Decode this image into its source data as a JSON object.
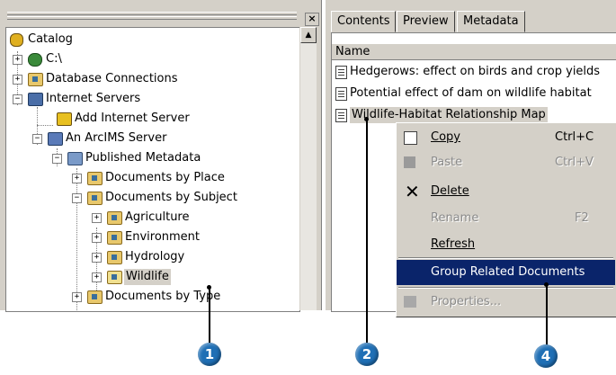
{
  "left": {
    "close_glyph": "×",
    "scroll_up_glyph": "▲",
    "tree": {
      "catalog": "Catalog",
      "c_drive": "C:\\",
      "db_connections": "Database Connections",
      "internet_servers": "Internet Servers",
      "add_internet_server": "Add Internet Server",
      "arcims_server": "An ArcIMS Server",
      "published_metadata": "Published Metadata",
      "docs_by_place": "Documents by Place",
      "docs_by_subject": "Documents by Subject",
      "agriculture": "Agriculture",
      "environment": "Environment",
      "hydrology": "Hydrology",
      "wildlife": "Wildlife",
      "docs_by_type": "Documents by Type"
    }
  },
  "right": {
    "tabs": [
      "Contents",
      "Preview",
      "Metadata"
    ],
    "column_name": "Name",
    "items": [
      "Hedgerows: effect on birds and crop yields",
      "Potential effect of dam on wildlife habitat",
      "Wildlife-Habitat Relationship Map"
    ]
  },
  "context_menu": {
    "copy": "Copy",
    "copy_sc": "Ctrl+C",
    "paste": "Paste",
    "paste_sc": "Ctrl+V",
    "delete": "Delete",
    "rename": "Rename",
    "rename_sc": "F2",
    "refresh": "Refresh",
    "group_related": "Group Related Documents",
    "properties": "Properties..."
  },
  "callouts": [
    "1",
    "2",
    "4"
  ],
  "colors": {
    "highlight": "#0a246a",
    "callout": "#1f6fb5",
    "panel": "#d4d0c8"
  }
}
